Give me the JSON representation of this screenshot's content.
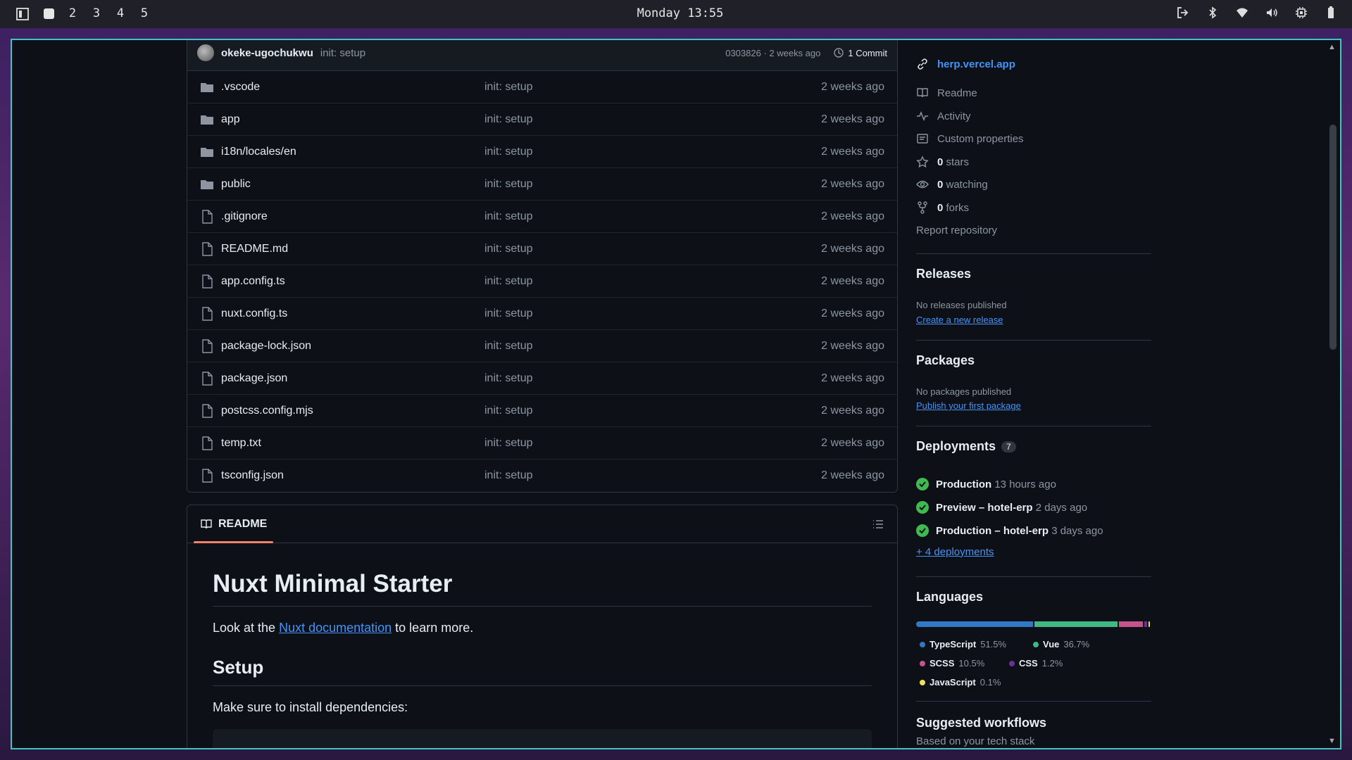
{
  "topbar": {
    "workspaces": [
      "2",
      "3",
      "4",
      "5"
    ],
    "clock": "Monday 13:55"
  },
  "commit": {
    "author": "okeke-ugochukwu",
    "message": "init: setup",
    "meta": "0303826 · 2 weeks ago",
    "count": "1 Commit"
  },
  "files": [
    {
      "name": ".vscode",
      "type": "folder",
      "msg": "init: setup",
      "date": "2 weeks ago"
    },
    {
      "name": "app",
      "type": "folder",
      "msg": "init: setup",
      "date": "2 weeks ago"
    },
    {
      "name": "i18n/locales/en",
      "type": "folder",
      "msg": "init: setup",
      "date": "2 weeks ago"
    },
    {
      "name": "public",
      "type": "folder",
      "msg": "init: setup",
      "date": "2 weeks ago"
    },
    {
      "name": ".gitignore",
      "type": "file",
      "msg": "init: setup",
      "date": "2 weeks ago"
    },
    {
      "name": "README.md",
      "type": "file",
      "msg": "init: setup",
      "date": "2 weeks ago"
    },
    {
      "name": "app.config.ts",
      "type": "file",
      "msg": "init: setup",
      "date": "2 weeks ago"
    },
    {
      "name": "nuxt.config.ts",
      "type": "file",
      "msg": "init: setup",
      "date": "2 weeks ago"
    },
    {
      "name": "package-lock.json",
      "type": "file",
      "msg": "init: setup",
      "date": "2 weeks ago"
    },
    {
      "name": "package.json",
      "type": "file",
      "msg": "init: setup",
      "date": "2 weeks ago"
    },
    {
      "name": "postcss.config.mjs",
      "type": "file",
      "msg": "init: setup",
      "date": "2 weeks ago"
    },
    {
      "name": "temp.txt",
      "type": "file",
      "msg": "init: setup",
      "date": "2 weeks ago"
    },
    {
      "name": "tsconfig.json",
      "type": "file",
      "msg": "init: setup",
      "date": "2 weeks ago"
    }
  ],
  "readme": {
    "tab_label": "README",
    "title": "Nuxt Minimal Starter",
    "intro_before": "Look at the ",
    "intro_link": "Nuxt documentation",
    "intro_after": " to learn more.",
    "setup_heading": "Setup",
    "setup_text": "Make sure to install dependencies:"
  },
  "sidebar": {
    "homepage": "herp.vercel.app",
    "links": {
      "readme": "Readme",
      "activity": "Activity",
      "custom_properties": "Custom properties",
      "stars_count": "0",
      "stars_label": " stars",
      "watching_count": "0",
      "watching_label": " watching",
      "forks_count": "0",
      "forks_label": " forks",
      "report": "Report repository"
    },
    "releases": {
      "heading": "Releases",
      "empty": "No releases published",
      "action": "Create a new release"
    },
    "packages": {
      "heading": "Packages",
      "empty": "No packages published",
      "action": "Publish your first package"
    },
    "deployments": {
      "heading": "Deployments",
      "count": "7",
      "items": [
        {
          "name": "Production",
          "time": "13 hours ago"
        },
        {
          "name": "Preview – hotel-erp",
          "time": "2 days ago"
        },
        {
          "name": "Production – hotel-erp",
          "time": "3 days ago"
        }
      ],
      "more": "+ 4 deployments"
    },
    "languages": {
      "heading": "Languages",
      "items": [
        {
          "name": "TypeScript",
          "percent": "51.5%",
          "value": 51.5,
          "color": "#3178c6"
        },
        {
          "name": "Vue",
          "percent": "36.7%",
          "value": 36.7,
          "color": "#41b883"
        },
        {
          "name": "SCSS",
          "percent": "10.5%",
          "value": 10.5,
          "color": "#c6538c"
        },
        {
          "name": "CSS",
          "percent": "1.2%",
          "value": 1.2,
          "color": "#663399"
        },
        {
          "name": "JavaScript",
          "percent": "0.1%",
          "value": 0.1,
          "color": "#f1e05a"
        }
      ]
    },
    "workflows": {
      "heading": "Suggested workflows",
      "sub": "Based on your tech stack"
    }
  }
}
